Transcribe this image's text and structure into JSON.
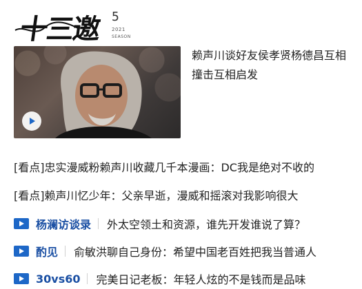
{
  "brand": {
    "logo_text": "十三邀",
    "season_number": "5",
    "season_year": "2021",
    "season_word": "SEASON"
  },
  "feature": {
    "title": "赖声川谈好友侯孝贤杨德昌互相撞击互相启发",
    "play_icon": "play-icon"
  },
  "news": [
    {
      "text": "[看点]忠实漫威粉赖声川收藏几千本漫画：DC我是绝对不收的"
    },
    {
      "text": "[看点]赖声川忆少年：父亲早逝，漫威和摇滚对我影响很大"
    }
  ],
  "columns": [
    {
      "icon": "play-icon",
      "name": "杨澜访谈录",
      "headline": "外太空领土和资源，谁先开发谁说了算？"
    },
    {
      "icon": "play-icon",
      "name": "酌见",
      "headline": "俞敏洪聊自己身份：希望中国老百姓把我当普通人"
    },
    {
      "icon": "play-icon",
      "name": "30vs60",
      "headline": "完美日记老板：年轻人炫的不是钱而是品味"
    }
  ],
  "colors": {
    "accent_blue": "#1d67c7",
    "column_name": "#1a4fa3",
    "text": "#222222"
  }
}
